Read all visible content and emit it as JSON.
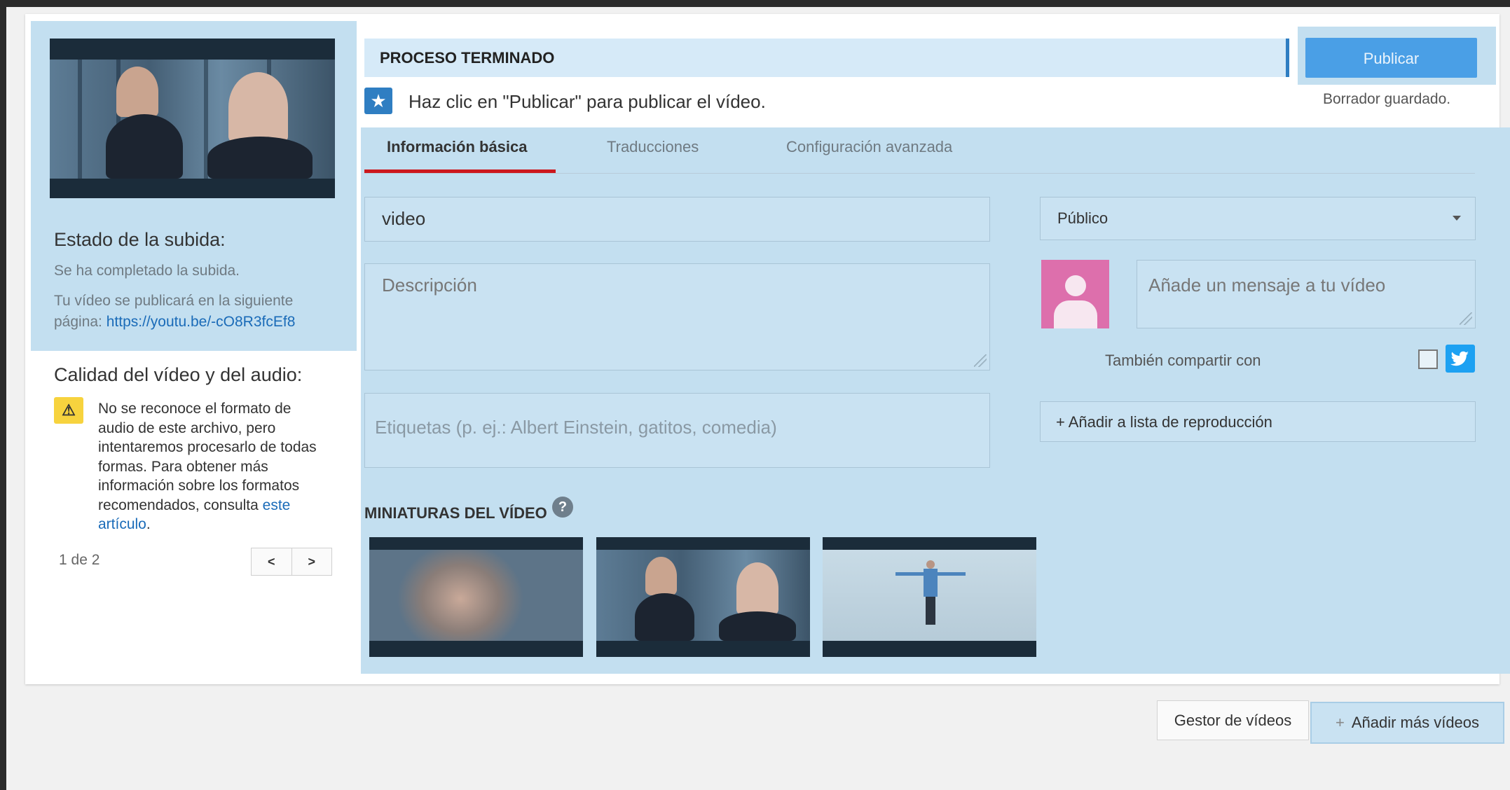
{
  "left_panel": {
    "upload_status_title": "Estado de la subida:",
    "upload_complete": "Se ha completado la subida.",
    "publish_notice_line1": "Tu vídeo se publicará en la siguiente",
    "publish_notice_prefix": "página: ",
    "video_url": "https://youtu.be/-cO8R3fcEf8",
    "quality_title": "Calidad del vídeo y del audio:",
    "warning_text": "No se reconoce el formato de audio de este archivo, pero intentaremos procesarlo de todas formas. Para obtener más información sobre los formatos recomendados, consulta ",
    "warning_link": "este artículo",
    "warning_end": ".",
    "pager": "1 de 2",
    "prev_symbol": "<",
    "next_symbol": ">"
  },
  "header": {
    "status": "PROCESO TERMINADO",
    "publish_label": "Publicar",
    "hint": "Haz clic en \"Publicar\" para publicar el vídeo.",
    "draft_status": "Borrador guardado."
  },
  "tabs": [
    {
      "label": "Información básica",
      "active": true
    },
    {
      "label": "Traducciones",
      "active": false
    },
    {
      "label": "Configuración avanzada",
      "active": false
    }
  ],
  "form": {
    "title_value": "video",
    "description_placeholder": "Descripción",
    "tags_placeholder": "Etiquetas (p. ej.: Albert Einstein, gatitos, comedia)",
    "privacy_value": "Público",
    "message_placeholder": "Añade un mensaje a tu vídeo",
    "share_label": "También compartir con",
    "playlist_label": "+ Añadir a lista de reproducción"
  },
  "thumbnails": {
    "section_label": "MINIATURAS DEL VÍDEO",
    "help_symbol": "?"
  },
  "footer": {
    "manager_label": "Gestor de vídeos",
    "add_more_plus": "+",
    "add_more_label": "Añadir más vídeos"
  },
  "icons": {
    "star": "star-icon",
    "warning": "warning-icon",
    "help": "help-icon",
    "twitter": "twitter-icon",
    "avatar": "avatar-icon"
  },
  "colors": {
    "accent": "#4a9fe6",
    "highlight": "#c3dff0",
    "tab_active": "#cc181e",
    "link": "#1a6bb8",
    "warning": "#f7d33e",
    "avatar": "#dd6fac",
    "twitter": "#1da1f2"
  }
}
